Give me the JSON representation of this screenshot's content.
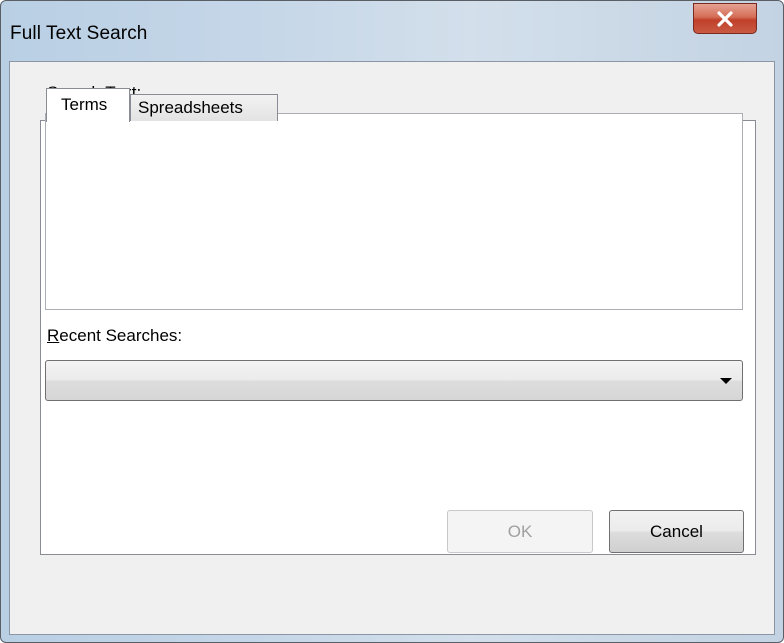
{
  "window": {
    "title": "Full Text Search",
    "close_icon": "close-x-icon"
  },
  "tabs": [
    {
      "label": "Terms",
      "selected": true
    },
    {
      "label": "Spreadsheets",
      "selected": false
    }
  ],
  "terms": {
    "search_label_prefix": "S",
    "search_label_rest": "earch Text:",
    "search_text_value": "",
    "recent_label_prefix": "R",
    "recent_label_rest": "ecent Searches:",
    "recent_selected": "",
    "dropdown_icon": "chevron-down-icon"
  },
  "buttons": {
    "ok_label": "OK",
    "ok_enabled": false,
    "cancel_label": "Cancel"
  },
  "colors": {
    "close_button": "#c95a43",
    "disabled_text": "#a0a0a0",
    "titlebar": "#c6d7e8"
  }
}
